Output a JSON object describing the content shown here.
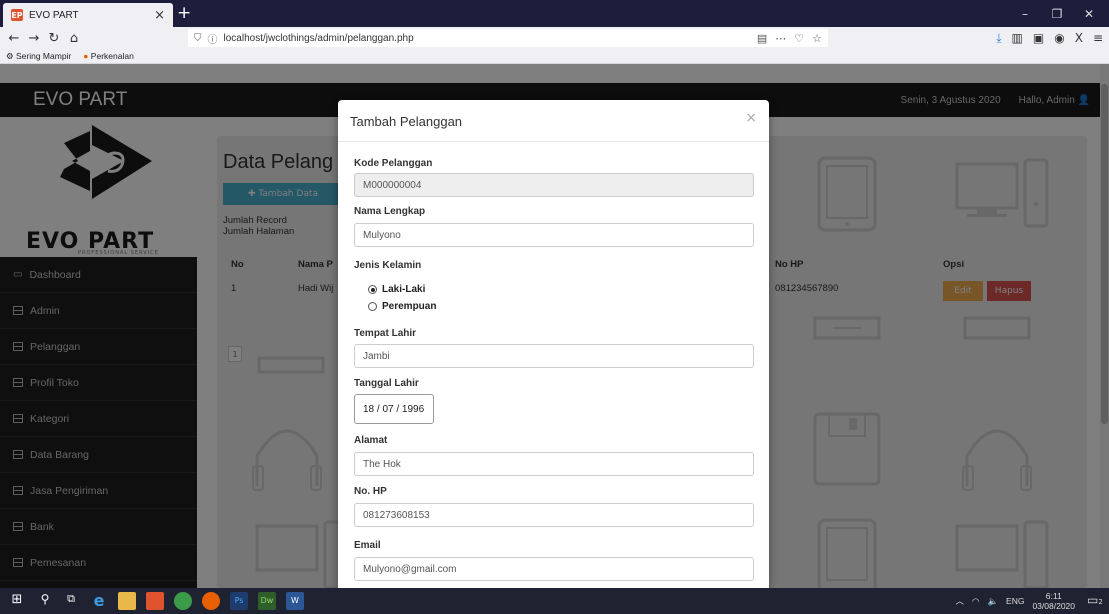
{
  "browser": {
    "tab_title": "EVO PART",
    "tab_favicon": "EP",
    "url": "localhost/jwclothings/admin/pelanggan.php",
    "bookmarks": [
      "Sering Mampir",
      "Perkenalan"
    ]
  },
  "header": {
    "brand": "EVO PART",
    "date": "Senin, 3 Agustus 2020",
    "greeting": "Hallo, Admin"
  },
  "logo": {
    "text": "EVO PART",
    "sub": "PROFESSIONAL SERVICE"
  },
  "sidebar": {
    "items": [
      {
        "label": "Dashboard"
      },
      {
        "label": "Admin"
      },
      {
        "label": "Pelanggan"
      },
      {
        "label": "Profil Toko"
      },
      {
        "label": "Kategori"
      },
      {
        "label": "Data Barang"
      },
      {
        "label": "Jasa Pengiriman"
      },
      {
        "label": "Bank"
      },
      {
        "label": "Pemesanan"
      }
    ]
  },
  "main": {
    "title": "Data Pelang",
    "add_button": "Tambah Data",
    "info_records": "Jumlah Record",
    "info_pages": "Jumlah Halaman",
    "col_no": "No",
    "col_nama": "Nama P",
    "col_hp": "No HP",
    "col_opsi": "Opsi",
    "row_no": "1",
    "row_nama": "Hadi Wij",
    "row_hp": "081234567890",
    "edit_label": "Edit",
    "hapus_label": "Hapus",
    "page_number": "1"
  },
  "modal": {
    "title": "Tambah Pelanggan",
    "close": "×",
    "kode_label": "Kode Pelanggan",
    "kode_value": "M000000004",
    "nama_label": "Nama Lengkap",
    "nama_value": "Mulyono",
    "jk_label": "Jenis Kelamin",
    "jk_option_1": "Laki-Laki",
    "jk_option_2": "Perempuan",
    "tempat_label": "Tempat Lahir",
    "tempat_value": "Jambi",
    "tanggal_label": "Tanggal Lahir",
    "tanggal_value": "18 / 07 / 1996",
    "alamat_label": "Alamat",
    "alamat_value": "The Hok",
    "hp_label": "No. HP",
    "hp_value": "081273608153",
    "email_label": "Email",
    "email_value": "Mulyono@gmail.com"
  },
  "taskbar": {
    "lang": "ENG",
    "time": "6:11",
    "date": "03/08/2020",
    "notif_count": "2"
  }
}
